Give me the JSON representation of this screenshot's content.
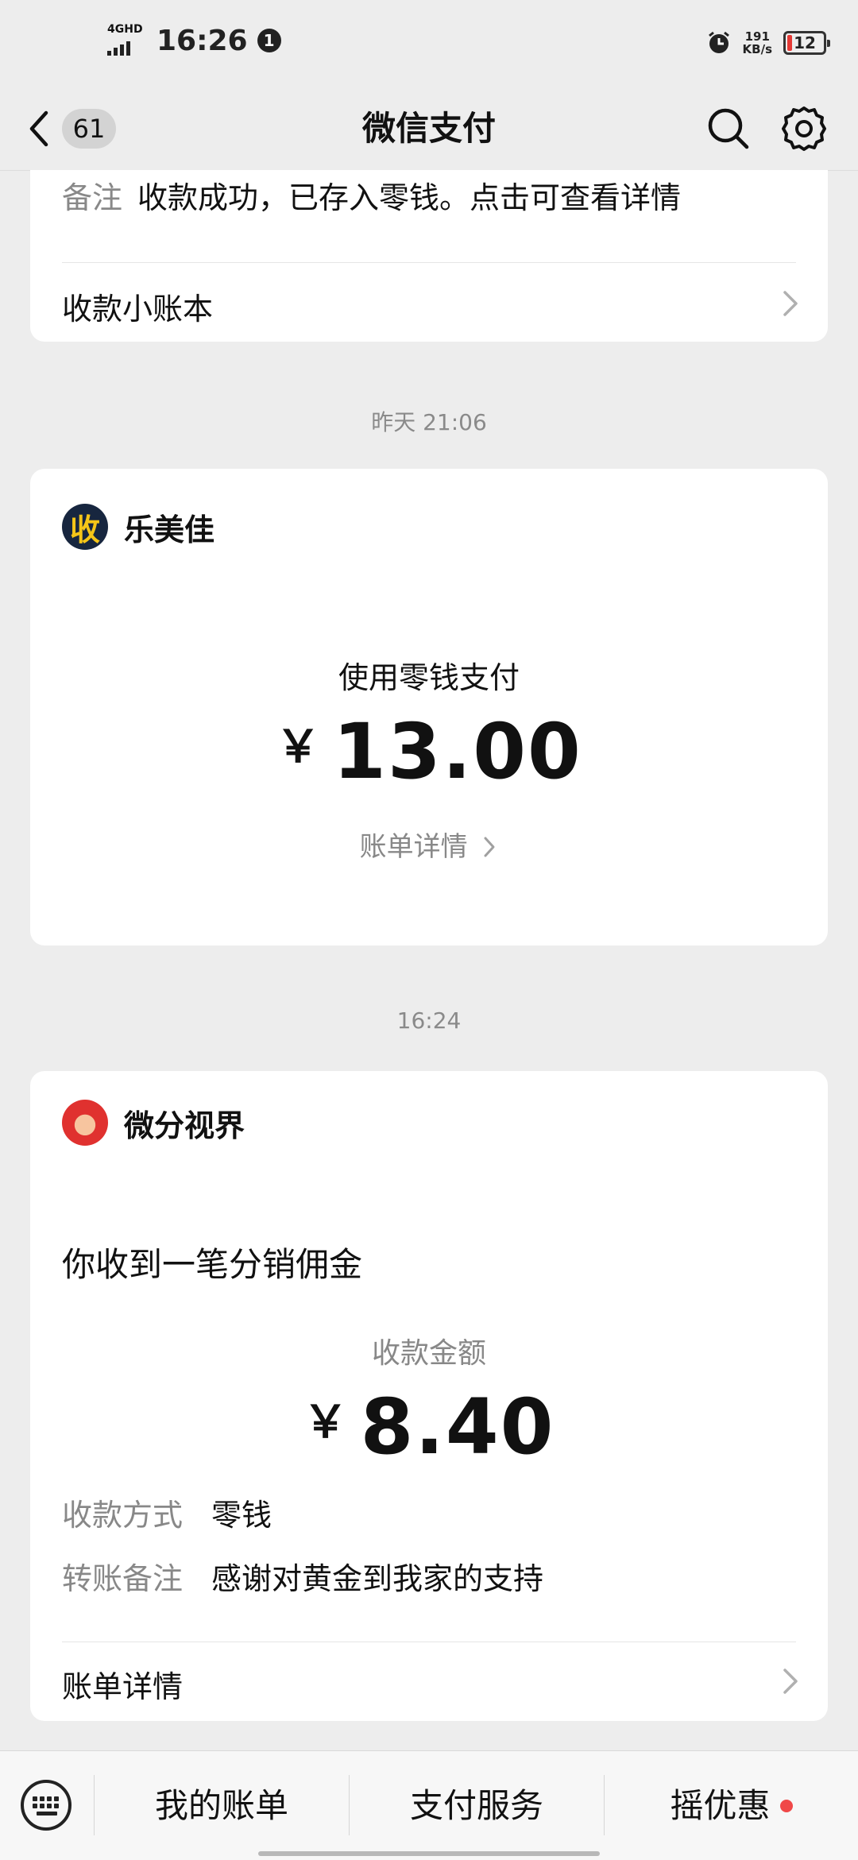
{
  "status_bar": {
    "network": "4GHD",
    "time": "16:26",
    "notification_count": "1",
    "speed_value": "191",
    "speed_unit": "KB/s",
    "battery": "12"
  },
  "nav": {
    "back_badge": "61",
    "title": "微信支付"
  },
  "top_card": {
    "remark_label": "备注",
    "remark_value": "收款成功，已存入零钱。点击可查看详情",
    "ledger_link": "收款小账本"
  },
  "timestamps": [
    "昨天 21:06",
    "16:24"
  ],
  "payment_card": {
    "merchant_icon_char": "收",
    "merchant_name": "乐美佳",
    "method": "使用零钱支付",
    "currency": "￥",
    "amount": "13.00",
    "detail_link": "账单详情"
  },
  "commission_card": {
    "merchant_name": "微分视界",
    "headline": "你收到一笔分销佣金",
    "amount_label": "收款金额",
    "currency": "￥",
    "amount": "8.40",
    "fields": [
      {
        "label": "收款方式",
        "value": "零钱"
      },
      {
        "label": "转账备注",
        "value": "感谢对黄金到我家的支持"
      }
    ],
    "detail_link": "账单详情"
  },
  "bottom_tabs": [
    "我的账单",
    "支付服务",
    "摇优惠"
  ],
  "icons": {
    "back": "chevron-left-icon",
    "search": "search-icon",
    "settings": "gear-icon",
    "keyboard": "keyboard-icon",
    "alarm": "alarm-icon"
  },
  "colors": {
    "background": "#ededed",
    "card": "#ffffff",
    "merchant_icon_bg": "#17263f",
    "merchant_icon_fg": "#f5c518",
    "red_dot": "#f04848"
  }
}
